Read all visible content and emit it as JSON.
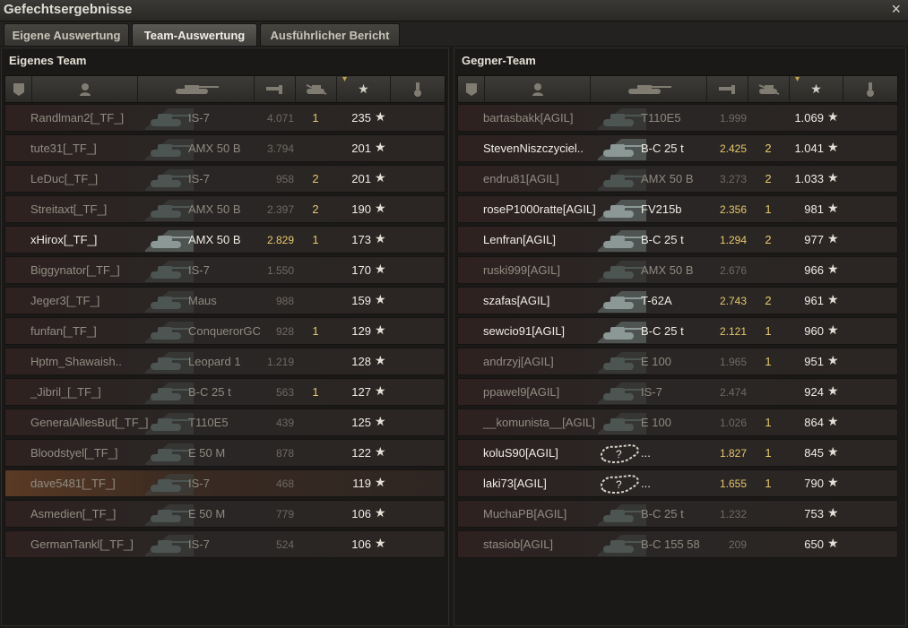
{
  "window": {
    "title": "Gefechtsergebnisse",
    "close_icon": "×"
  },
  "tabs": [
    {
      "label": "Eigene Auswertung"
    },
    {
      "label": "Team-Auswertung",
      "active": true
    },
    {
      "label": "Ausführlicher Bericht"
    }
  ],
  "own_team": {
    "title": "Eigenes Team",
    "header_icons": [
      "rank-icon",
      "player-icon",
      "tank-icon",
      "damage-icon",
      "kills-icon",
      "xp-star-icon",
      "medal-icon"
    ],
    "rows": [
      {
        "name": "Randlman2[_TF_]",
        "vehicle": "IS-7",
        "damage": "4.071",
        "kills": "1",
        "xp": "235",
        "alive": false
      },
      {
        "name": "tute31[_TF_]",
        "vehicle": "AMX 50 B",
        "damage": "3.794",
        "kills": "",
        "xp": "201",
        "alive": false
      },
      {
        "name": "LeDuc[_TF_]",
        "vehicle": "IS-7",
        "damage": "958",
        "kills": "2",
        "xp": "201",
        "alive": false
      },
      {
        "name": "Streitaxt[_TF_]",
        "vehicle": "AMX 50 B",
        "damage": "2.397",
        "kills": "2",
        "xp": "190",
        "alive": false
      },
      {
        "name": "xHirox[_TF_]",
        "vehicle": "AMX 50 B",
        "damage": "2.829",
        "kills": "1",
        "xp": "173",
        "alive": true
      },
      {
        "name": "Biggynator[_TF_]",
        "vehicle": "IS-7",
        "damage": "1.550",
        "kills": "",
        "xp": "170",
        "alive": false
      },
      {
        "name": "Jeger3[_TF_]",
        "vehicle": "Maus",
        "damage": "988",
        "kills": "",
        "xp": "159",
        "alive": false
      },
      {
        "name": "funfan[_TF_]",
        "vehicle": "ConquerorGC",
        "damage": "928",
        "kills": "1",
        "xp": "129",
        "alive": false
      },
      {
        "name": "Hptm_Shawaish..",
        "vehicle": "Leopard 1",
        "damage": "1.219",
        "kills": "",
        "xp": "128",
        "alive": false
      },
      {
        "name": "_Jibril_[_TF_]",
        "vehicle": "B-C 25 t",
        "damage": "563",
        "kills": "1",
        "xp": "127",
        "alive": false
      },
      {
        "name": "GeneralAllesBut[_TF_]",
        "vehicle": "T110E5",
        "damage": "439",
        "kills": "",
        "xp": "125",
        "alive": false
      },
      {
        "name": "Bloodstyel[_TF_]",
        "vehicle": "E 50 M",
        "damage": "878",
        "kills": "",
        "xp": "122",
        "alive": false
      },
      {
        "name": "dave5481[_TF_]",
        "vehicle": "IS-7",
        "damage": "468",
        "kills": "",
        "xp": "119",
        "alive": false,
        "me": true
      },
      {
        "name": "Asmedien[_TF_]",
        "vehicle": "E 50 M",
        "damage": "779",
        "kills": "",
        "xp": "106",
        "alive": false
      },
      {
        "name": "GermanTankl[_TF_]",
        "vehicle": "IS-7",
        "damage": "524",
        "kills": "",
        "xp": "106",
        "alive": false
      }
    ]
  },
  "enemy_team": {
    "title": "Gegner-Team",
    "header_icons": [
      "rank-icon",
      "player-icon",
      "tank-icon",
      "damage-icon",
      "kills-icon",
      "xp-star-icon",
      "medal-icon"
    ],
    "rows": [
      {
        "name": "bartasbakk[AGIL]",
        "vehicle": "T110E5",
        "damage": "1.999",
        "kills": "",
        "xp": "1.069",
        "alive": false
      },
      {
        "name": "StevenNiszczyciel..",
        "vehicle": "B-C 25 t",
        "damage": "2.425",
        "kills": "2",
        "xp": "1.041",
        "alive": true
      },
      {
        "name": "endru81[AGIL]",
        "vehicle": "AMX 50 B",
        "damage": "3.273",
        "kills": "2",
        "xp": "1.033",
        "alive": false
      },
      {
        "name": "roseP1000ratte[AGIL]",
        "vehicle": "FV215b",
        "damage": "2.356",
        "kills": "1",
        "xp": "981",
        "alive": true
      },
      {
        "name": "Lenfran[AGIL]",
        "vehicle": "B-C 25 t",
        "damage": "1.294",
        "kills": "2",
        "xp": "977",
        "alive": true
      },
      {
        "name": "ruski999[AGIL]",
        "vehicle": "AMX 50 B",
        "damage": "2.676",
        "kills": "",
        "xp": "966",
        "alive": false
      },
      {
        "name": "szafas[AGIL]",
        "vehicle": "T-62A",
        "damage": "2.743",
        "kills": "2",
        "xp": "961",
        "alive": true
      },
      {
        "name": "sewcio91[AGIL]",
        "vehicle": "B-C 25 t",
        "damage": "2.121",
        "kills": "1",
        "xp": "960",
        "alive": true
      },
      {
        "name": "andrzyj[AGIL]",
        "vehicle": "E 100",
        "damage": "1.965",
        "kills": "1",
        "xp": "951",
        "alive": false
      },
      {
        "name": "ppawel9[AGIL]",
        "vehicle": "IS-7",
        "damage": "2.474",
        "kills": "",
        "xp": "924",
        "alive": false
      },
      {
        "name": "__komunista__[AGIL]",
        "vehicle": "E 100",
        "damage": "1.026",
        "kills": "1",
        "xp": "864",
        "alive": false
      },
      {
        "name": "koluS90[AGIL]",
        "vehicle": "...",
        "damage": "1.827",
        "kills": "1",
        "xp": "845",
        "alive": true,
        "unknown": true
      },
      {
        "name": "laki73[AGIL]",
        "vehicle": "...",
        "damage": "1.655",
        "kills": "1",
        "xp": "790",
        "alive": true,
        "unknown": true
      },
      {
        "name": "MuchaPB[AGIL]",
        "vehicle": "B-C 25 t",
        "damage": "1.232",
        "kills": "",
        "xp": "753",
        "alive": false
      },
      {
        "name": "stasiob[AGIL]",
        "vehicle": "B-C 155 58",
        "damage": "209",
        "kills": "",
        "xp": "650",
        "alive": false
      }
    ]
  }
}
